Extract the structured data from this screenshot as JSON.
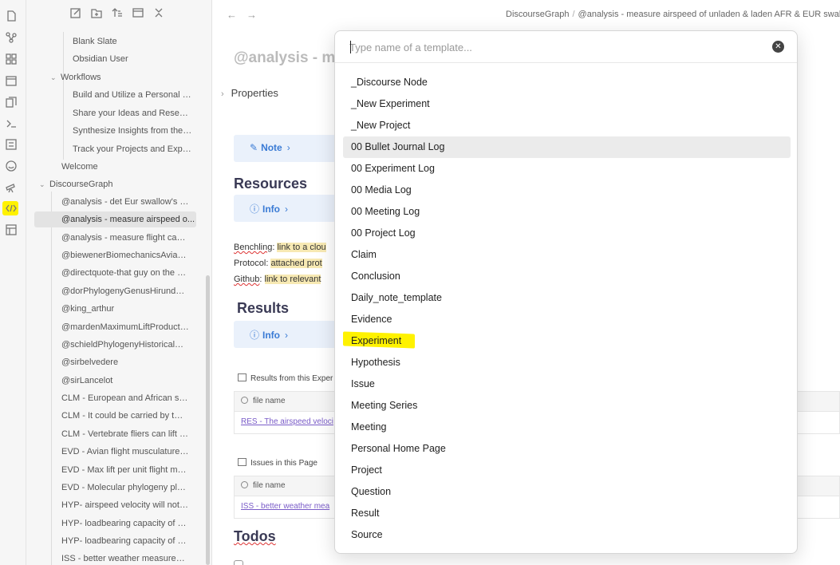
{
  "ribbon": {
    "icons": [
      "file-icon",
      "graph-icon",
      "blocks-icon",
      "calendar-icon",
      "copy-icon",
      "terminal-icon",
      "list-icon",
      "smile-icon",
      "telescope-icon",
      "percent-code-icon",
      "layout-icon"
    ]
  },
  "sidebar": {
    "toolbar": [
      "new-note-icon",
      "new-folder-icon",
      "sort-icon",
      "collapse-view-icon",
      "collapse-all-icon"
    ],
    "items": [
      {
        "label": "Blank Slate"
      },
      {
        "label": "Obsidian User"
      },
      {
        "label": "Workflows"
      },
      {
        "label": "Build and Utilize a Personal K..."
      },
      {
        "label": "Share your Ideas and Research"
      },
      {
        "label": "Synthesize Insights from the ..."
      },
      {
        "label": "Track your Projects and Expe..."
      },
      {
        "label": "Welcome"
      },
      {
        "label": "DiscourseGraph"
      },
      {
        "label": "@analysis - det Eur swallow's fli..."
      },
      {
        "label": "@analysis - measure airspeed o..."
      },
      {
        "label": "@analysis - measure flight capa..."
      },
      {
        "label": "@biewenerBiomechanicsAvianFl..."
      },
      {
        "label": "@directquote-that guy on the b..."
      },
      {
        "label": "@dorPhylogenyGenusHirundo2..."
      },
      {
        "label": "@king_arthur"
      },
      {
        "label": "@mardenMaximumLiftProducti..."
      },
      {
        "label": "@schieldPhylogenyHistoricalBio..."
      },
      {
        "label": "@sirbelvedere"
      },
      {
        "label": "@sirLancelot"
      },
      {
        "label": "CLM - European and African sw..."
      },
      {
        "label": "CLM - It could be carried by two..."
      },
      {
        "label": "CLM - Vertebrate fliers can lift ~..."
      },
      {
        "label": "EVD - Avian flight musculature ..."
      },
      {
        "label": "EVD - Max lift per unit flight mu..."
      },
      {
        "label": "EVD - Molecular phylogeny plac..."
      },
      {
        "label": "HYP- airspeed velocity will not ..."
      },
      {
        "label": "HYP- loadbearing capacity of a ..."
      },
      {
        "label": "HYP- loadbearing capacity of a ..."
      },
      {
        "label": "ISS - better weather measureme..."
      }
    ]
  },
  "main": {
    "breadcrumb": [
      "DiscourseGraph",
      "@analysis - measure airspeed of unladen & laden AFR & EUR swallow"
    ],
    "breadcrumb_sep": "/",
    "title": "@analysis - me",
    "properties_label": "Properties",
    "note_callout": "Note",
    "resources_heading": "Resources",
    "info_callout_1": "Info",
    "benchling_label": "Benchling",
    "benchling_value": "link to a clou",
    "protocol_label": "Protocol",
    "protocol_value": "attached prot",
    "github_label": "Github",
    "github_value": "link to relevant",
    "results_heading": "Results",
    "info_callout_2": "Info",
    "results_table_title": "Results from this Exper",
    "results_col": "file name",
    "results_link": "RES - The airspeed veloci",
    "issues_table_title": "Issues in this Page",
    "issues_col": "file name",
    "issues_link": "ISS - better weather mea",
    "todos_heading": "Todos"
  },
  "modal": {
    "placeholder": "Type name of a template...",
    "options": [
      "_Discourse Node",
      "_New Experiment",
      "_New Project",
      "00 Bullet Journal Log",
      "00 Experiment Log",
      "00 Media Log",
      "00 Meeting Log",
      "00 Project Log",
      "Claim",
      "Conclusion",
      "Daily_note_template",
      "Evidence",
      "Experiment",
      "Hypothesis",
      "Issue",
      "Meeting Series",
      "Meeting",
      "Personal Home Page",
      "Project",
      "Question",
      "Result",
      "Source"
    ],
    "selected_index": 3,
    "highlighted_index": 12
  },
  "colors": {
    "highlight": "#fff200",
    "accent": "#3a7bd5",
    "link": "#7a5cc8"
  }
}
